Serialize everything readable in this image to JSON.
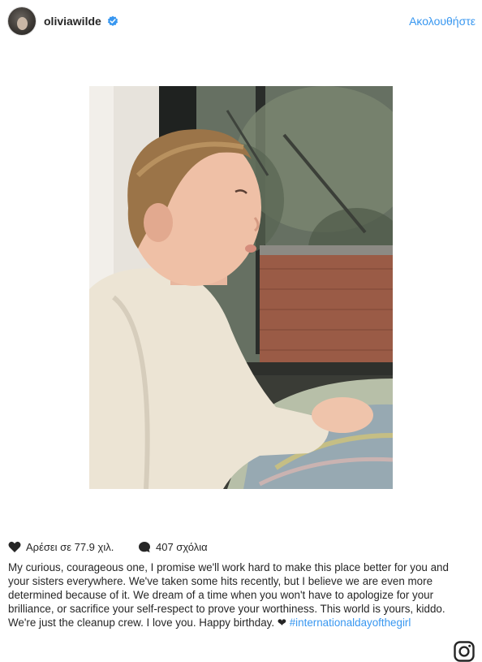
{
  "header": {
    "username": "oliviawilde",
    "verified_icon": "verified-badge-icon",
    "follow_label": "Ακολουθήστε"
  },
  "post": {
    "image_icon": "photo"
  },
  "stats": {
    "likes_label": "Αρέσει σε 77.9 χιλ.",
    "comments_label": "407 σχόλια"
  },
  "caption": {
    "text": "My curious, courageous one, I promise we'll work hard to make this place better for you and your sisters everywhere. We've taken some hits recently, but I believe we are even more determined because of it. We dream of a time when you won't have to apologize for your brilliance, or sacrifice your self-respect to prove your worthiness. This world is yours, kiddo. We're just the cleanup crew. I love you. Happy birthday. ❤ ",
    "hashtag": "#internationaldayofthegirl"
  },
  "colors": {
    "link": "#3897f0",
    "text": "#262626"
  }
}
